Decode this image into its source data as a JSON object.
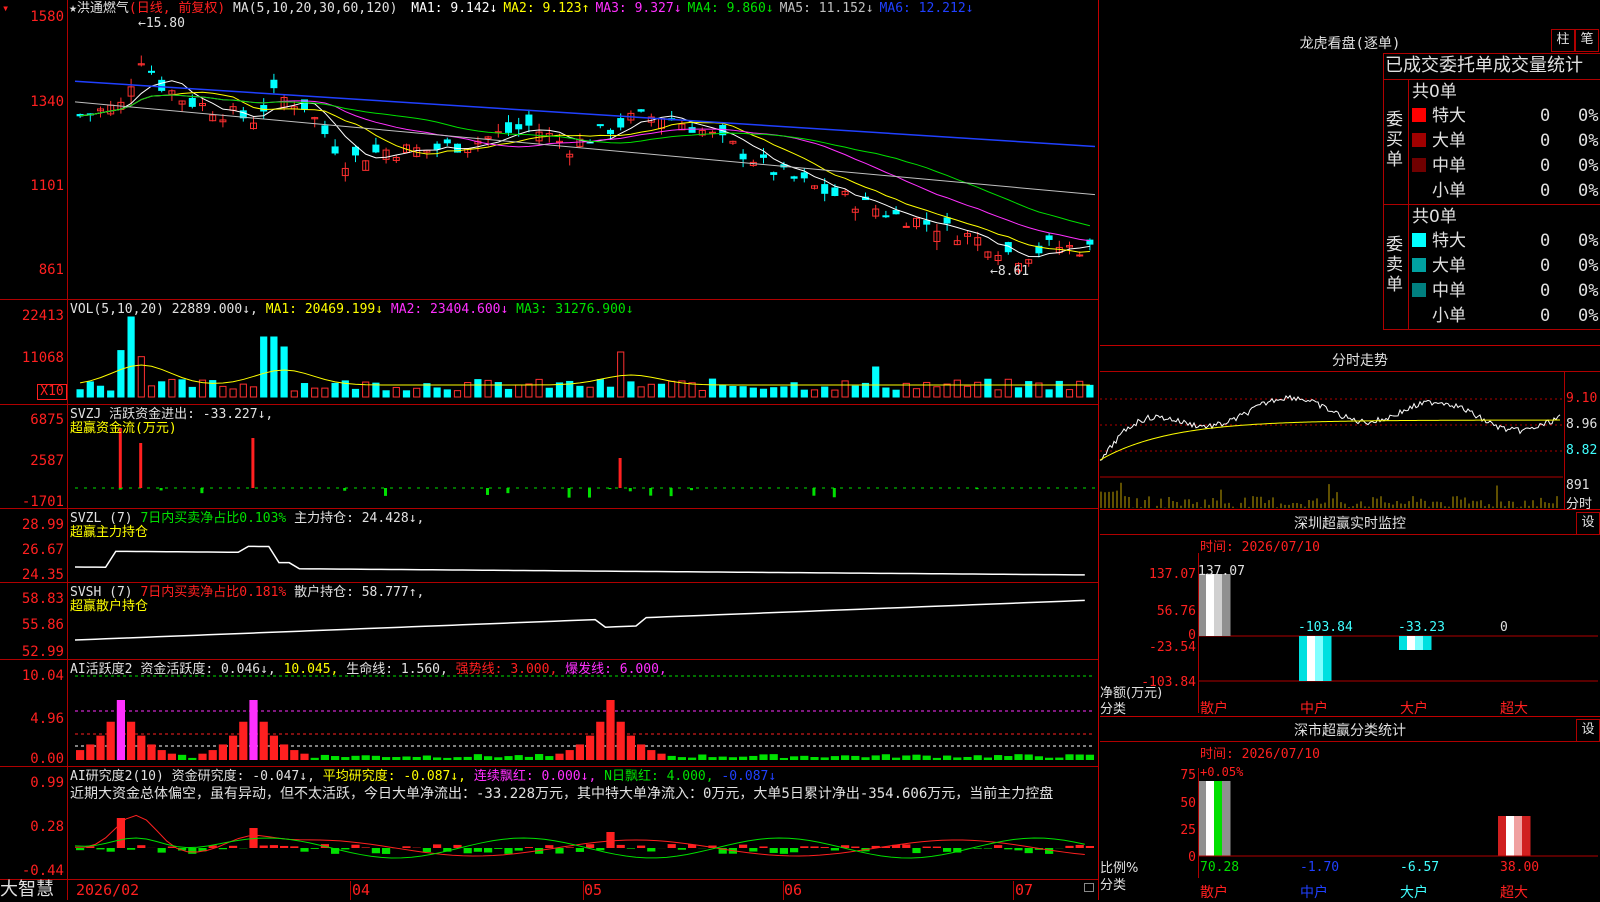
{
  "stock": {
    "name_mark": "★",
    "name": "洪通燃气",
    "period": "(日线, 前复权)"
  },
  "main": {
    "ma_label": "MA(5,10,20,30,60,120)",
    "ma": [
      {
        "name": "MA1",
        "value": "9.142↓",
        "color": "#ffffff"
      },
      {
        "name": "MA2",
        "value": "9.123↑",
        "color": "#ffff00"
      },
      {
        "name": "MA3",
        "value": "9.327↓",
        "color": "#ff30ff"
      },
      {
        "name": "MA4",
        "value": "9.860↓",
        "color": "#00e000"
      },
      {
        "name": "MA5",
        "value": "11.152↓",
        "color": "#c0c0c0"
      },
      {
        "name": "MA6",
        "value": "12.212↓",
        "color": "#2040ff"
      }
    ],
    "y_labels": [
      "1580",
      "1340",
      "1101",
      "861"
    ],
    "high_label": "←15.80",
    "low_label": "←8.61"
  },
  "vol": {
    "label": "VOL(5,10,20)",
    "value": "22889.000↓",
    "ma1": "MA1: 20469.199↓",
    "ma2": "MA2: 23404.600↓",
    "ma3": "MA3: 31276.900↓",
    "y_labels": [
      "22413",
      "11068"
    ],
    "unit": "X10"
  },
  "svzj": {
    "label": "SVZJ",
    "text": "活跃资金进出: -33.227↓,",
    "sub": "超赢资金流(万元)",
    "y_labels": [
      "6875",
      "2587",
      "-1701"
    ]
  },
  "svzl": {
    "label": "SVZL (7)",
    "text1": "7日内买卖净占比0.103%",
    "text2": "主力持仓: 24.428↓,",
    "sub": "超赢主力持仓",
    "y_labels": [
      "28.99",
      "26.67",
      "24.35"
    ]
  },
  "svsh": {
    "label": "SVSH (7)",
    "text1": "7日内买卖净占比0.181%",
    "text2": "散户持仓: 58.777↑,",
    "sub": "超赢散户持仓",
    "y_labels": [
      "58.83",
      "55.86",
      "52.99"
    ]
  },
  "ai1": {
    "label": "AI活跃度2",
    "t1": "资金活跃度: 0.046↓,",
    "t2": "10.045,",
    "t3": "生命线: 1.560,",
    "t4": "强势线: 3.000,",
    "t5": "爆发线: 6.000,",
    "y_labels": [
      "10.04",
      "4.96",
      "0.00"
    ]
  },
  "ai2": {
    "label": "AI研究度2(10)",
    "t1": "资金研究度: -0.047↓,",
    "t2": "平均研究度: -0.087↓,",
    "t3": "连续飘红: 0.000↓,",
    "t4": "N日飘红: 4.000,",
    "t5": "-0.087↓",
    "summary": "近期大资金总体偏空，虽有异动，但不太活跃，今日大单净流出：-33.228万元，其中特大单净流入：0万元，大单5日累计净出-354.606万元，当前主力控盘",
    "y_labels": [
      "0.99",
      "0.28",
      "-0.44"
    ]
  },
  "xaxis": [
    "2026/02",
    "04",
    "05",
    "06",
    "07"
  ],
  "logo": "大智慧",
  "lhb": {
    "title": "龙虎看盘(逐单)",
    "btn1": "柱",
    "btn2": "笔",
    "subtitle": "已成交委托单成交量统计",
    "buy": {
      "side": "委买单",
      "total": "共0单",
      "rows": [
        {
          "label": "特大",
          "n": "0",
          "p": "0%",
          "color": "#ff0000"
        },
        {
          "label": "大单",
          "n": "0",
          "p": "0%",
          "color": "#a00000"
        },
        {
          "label": "中单",
          "n": "0",
          "p": "0%",
          "color": "#700000"
        },
        {
          "label": "小单",
          "n": "0",
          "p": "0%",
          "color": "#000000"
        }
      ]
    },
    "sell": {
      "side": "委卖单",
      "total": "共0单",
      "rows": [
        {
          "label": "特大",
          "n": "0",
          "p": "0%",
          "color": "#00ffff"
        },
        {
          "label": "大单",
          "n": "0",
          "p": "0%",
          "color": "#00a0a0"
        },
        {
          "label": "中单",
          "n": "0",
          "p": "0%",
          "color": "#008080"
        },
        {
          "label": "小单",
          "n": "0",
          "p": "0%",
          "color": "#000000"
        }
      ]
    }
  },
  "intraday": {
    "title": "分时走势",
    "labels": [
      "9.10",
      "8.96",
      "8.82",
      "891",
      "分时"
    ]
  },
  "sz": {
    "title": "深圳超赢实时监控",
    "btn": "设",
    "time": "时间: 2026/07/10",
    "y_labels": [
      "137.07",
      "56.76",
      "0",
      "-23.54",
      "-103.84"
    ],
    "unit": "净额(万元)",
    "cat_label": "分类",
    "values": [
      "137.07",
      "-103.84",
      "-33.23",
      "0"
    ],
    "cats": [
      "散户",
      "中户",
      "大户",
      "超大"
    ]
  },
  "szcls": {
    "title": "深市超赢分类统计",
    "btn": "设",
    "time": "时间: 2026/07/10",
    "y_labels": [
      "75",
      "50",
      "25",
      "0"
    ],
    "top": "+0.05%",
    "unit": "比例%",
    "cat_label": "分类",
    "values": [
      "70.28",
      "-1.70",
      "-6.57",
      "38.00"
    ],
    "cats": [
      "散户",
      "中户",
      "大户",
      "超大"
    ]
  }
}
